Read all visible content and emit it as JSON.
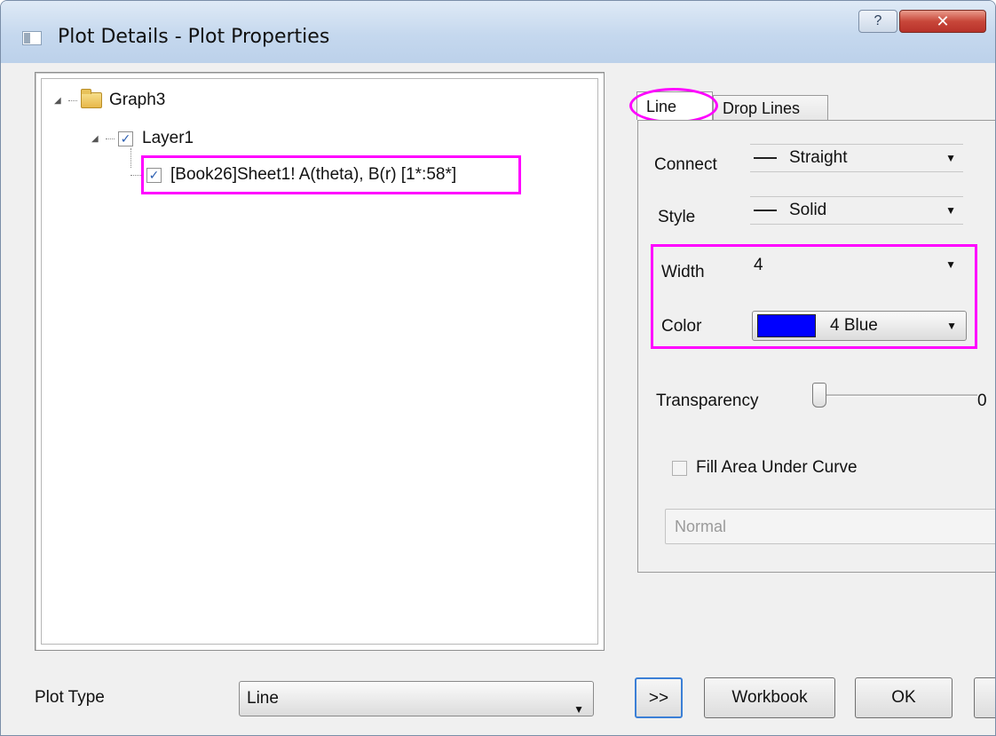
{
  "window": {
    "title": "Plot Details - Plot Properties",
    "help_label": "?",
    "close_label": "✕"
  },
  "tree": {
    "root": {
      "label": "Graph3"
    },
    "layer": {
      "label": "Layer1",
      "checked": true
    },
    "plot": {
      "label": "[Book26]Sheet1! A(theta), B(r) [1*:58*]",
      "checked": true
    }
  },
  "tabs": [
    {
      "label": "Line"
    },
    {
      "label": "Drop Lines"
    }
  ],
  "line_tab": {
    "connect": {
      "label": "Connect",
      "value": "Straight"
    },
    "style": {
      "label": "Style",
      "value": "Solid"
    },
    "width": {
      "label": "Width",
      "value": "4"
    },
    "color": {
      "label": "Color",
      "value": "4 Blue",
      "swatch": "#0000ff"
    },
    "transparency": {
      "label": "Transparency",
      "value_partial": "0",
      "level": 0
    },
    "fill_area": {
      "label": "Fill Area Under Curve",
      "checked": false
    },
    "fill_mode": {
      "value": "Normal"
    }
  },
  "bottom": {
    "plot_type": {
      "label": "Plot Type",
      "value": "Line"
    },
    "expand_label": ">>",
    "workbook_label": "Workbook",
    "ok_label": "OK"
  },
  "colors": {
    "highlight": "#ff00ff",
    "blue_swatch": "#0000ff"
  }
}
